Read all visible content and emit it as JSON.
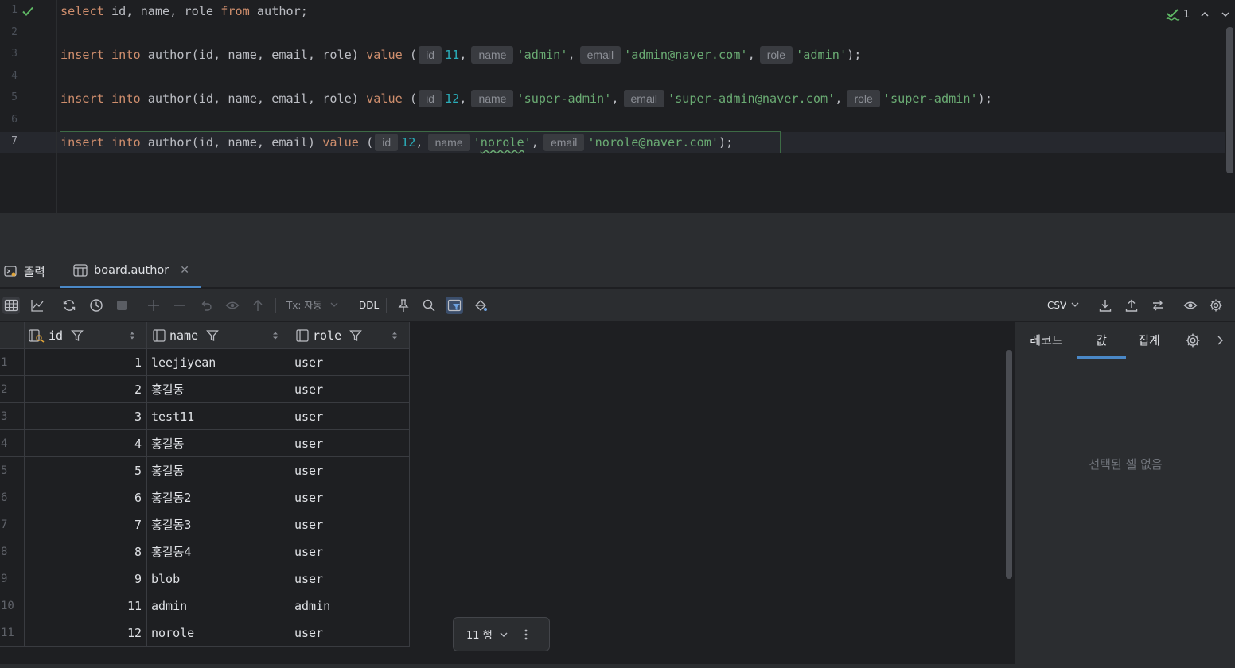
{
  "editor": {
    "line_numbers": [
      "1",
      "2",
      "3",
      "4",
      "5",
      "6",
      "7"
    ],
    "line1": {
      "select": "select",
      "cols": " id, name, role ",
      "from": "from",
      "table": " author;"
    },
    "line3": {
      "insert": "insert",
      "into": "into",
      "target": " author(id, name, email, role) ",
      "value_kw": "value",
      "open": " (",
      "hint_id": "id",
      "id_val": "11",
      "sep1": ",",
      "hint_name": "name",
      "name_val": "'admin'",
      "sep2": ",",
      "hint_email": "email",
      "email_val": "'admin@naver.com'",
      "sep3": ",",
      "hint_role": "role",
      "role_val": "'admin'",
      "close": ");"
    },
    "line5": {
      "insert": "insert",
      "into": "into",
      "target": " author(id, name, email, role) ",
      "value_kw": "value",
      "open": " (",
      "hint_id": "id",
      "id_val": "12",
      "sep1": ",",
      "hint_name": "name",
      "name_val": "'super-admin'",
      "sep2": ",",
      "hint_email": "email",
      "email_val": "'super-admin@naver.com'",
      "sep3": ",",
      "hint_role": "role",
      "role_val": "'super-admin'",
      "close": ");"
    },
    "line7": {
      "insert": "insert",
      "into": "into",
      "target": " author(id, name, email) ",
      "value_kw": "value",
      "open": " (",
      "hint_id": "id",
      "id_val": "12",
      "sep1": ",",
      "hint_name": "name",
      "name_q1": "'",
      "name_val": "norole",
      "name_q2": "'",
      "sep2": ",",
      "hint_email": "email",
      "email_val": "'norole@naver.com'",
      "close": ")",
      "semi": ";"
    },
    "problems_count": "1"
  },
  "tool_window": {
    "tabs": [
      {
        "label": "출력"
      },
      {
        "label": "board.author"
      }
    ]
  },
  "toolbar": {
    "tx_label": "Tx: 자동",
    "ddl_label": "DDL",
    "export_format": "CSV"
  },
  "grid": {
    "columns": [
      {
        "name": "id"
      },
      {
        "name": "name"
      },
      {
        "name": "role"
      }
    ],
    "rows": [
      {
        "n": "1",
        "id": "1",
        "name": "leejiyean",
        "role": "user"
      },
      {
        "n": "2",
        "id": "2",
        "name": "홍길동",
        "role": "user"
      },
      {
        "n": "3",
        "id": "3",
        "name": "test11",
        "role": "user"
      },
      {
        "n": "4",
        "id": "4",
        "name": "홍길동",
        "role": "user"
      },
      {
        "n": "5",
        "id": "5",
        "name": "홍길동",
        "role": "user"
      },
      {
        "n": "6",
        "id": "6",
        "name": "홍길동2",
        "role": "user"
      },
      {
        "n": "7",
        "id": "7",
        "name": "홍길동3",
        "role": "user"
      },
      {
        "n": "8",
        "id": "8",
        "name": "홍길동4",
        "role": "user"
      },
      {
        "n": "9",
        "id": "9",
        "name": "blob",
        "role": "user"
      },
      {
        "n": "10",
        "id": "11",
        "name": "admin",
        "role": "admin"
      },
      {
        "n": "11",
        "id": "12",
        "name": "norole",
        "role": "user"
      }
    ],
    "row_count_label": "11 행"
  },
  "side_panel": {
    "tabs": [
      {
        "label": "레코드"
      },
      {
        "label": "값"
      },
      {
        "label": "집계"
      }
    ],
    "empty_message": "선택된 셀 없음"
  },
  "colors": {
    "background": "#1e1f22",
    "panel": "#2b2d30",
    "keyword": "#cf8e6d",
    "string": "#6aab73",
    "number": "#2aacb8",
    "accent": "#4a88c7"
  }
}
